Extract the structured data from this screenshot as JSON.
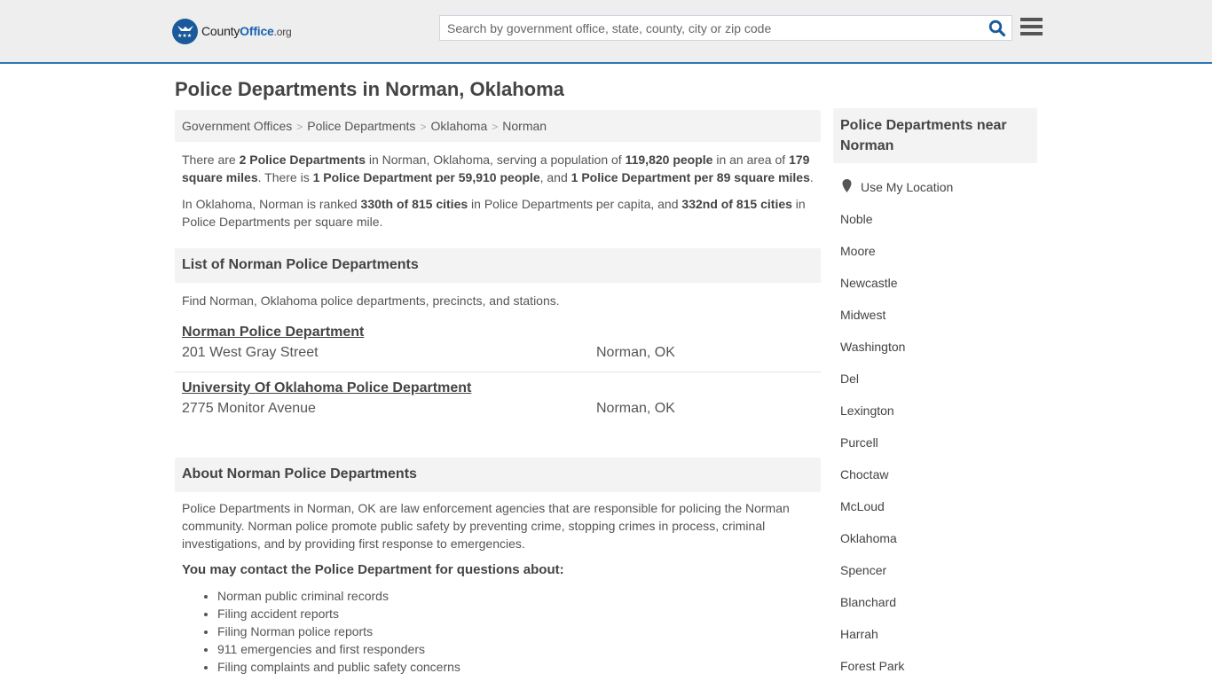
{
  "header": {
    "logo": {
      "county": "County",
      "office": "Office",
      "org": ".org"
    },
    "search_placeholder": "Search by government office, state, county, city or zip code",
    "search_value": "",
    "accent_color": "#2e77b5"
  },
  "page_title": "Police Departments in Norman, Oklahoma",
  "breadcrumb": [
    "Government Offices",
    "Police Departments",
    "Oklahoma",
    "Norman"
  ],
  "summary": {
    "p1": {
      "t1": "There are ",
      "b1": "2 Police Departments",
      "t2": " in Norman, Oklahoma, serving a population of ",
      "b2": "119,820 people",
      "t3": " in an area of ",
      "b3": "179 square miles",
      "t4": ". There is ",
      "b4": "1 Police Department per 59,910 people",
      "t5": ", and ",
      "b5": "1 Police Department per 89 square miles",
      "t6": "."
    },
    "p2": {
      "t1": "In Oklahoma, Norman is ranked ",
      "b1": "330th of 815 cities",
      "t2": " in Police Departments per capita, and ",
      "b2": "332nd of 815 cities",
      "t3": " in Police Departments per square mile."
    }
  },
  "list_section": {
    "heading": "List of Norman Police Departments",
    "intro": "Find Norman, Oklahoma police departments, precincts, and stations.",
    "departments": [
      {
        "name": "Norman Police Department",
        "address": "201 West Gray Street",
        "city": "Norman, OK"
      },
      {
        "name": "University Of Oklahoma Police Department",
        "address": "2775 Monitor Avenue",
        "city": "Norman, OK"
      }
    ]
  },
  "about_section": {
    "heading": "About Norman Police Departments",
    "paragraph": "Police Departments in Norman, OK are law enforcement agencies that are responsible for policing the Norman community. Norman police promote public safety by preventing crime, stopping crimes in process, criminal investigations, and by providing first response to emergencies.",
    "contact_heading": "You may contact the Police Department for questions about:",
    "contact_items": [
      "Norman public criminal records",
      "Filing accident reports",
      "Filing Norman police reports",
      "911 emergencies and first responders",
      "Filing complaints and public safety concerns"
    ]
  },
  "sidebar": {
    "heading": "Police Departments near Norman",
    "use_location": "Use My Location",
    "cities": [
      "Noble",
      "Moore",
      "Newcastle",
      "Midwest",
      "Washington",
      "Del",
      "Lexington",
      "Purcell",
      "Choctaw",
      "McLoud",
      "Oklahoma",
      "Spencer",
      "Blanchard",
      "Harrah",
      "Forest Park"
    ]
  }
}
